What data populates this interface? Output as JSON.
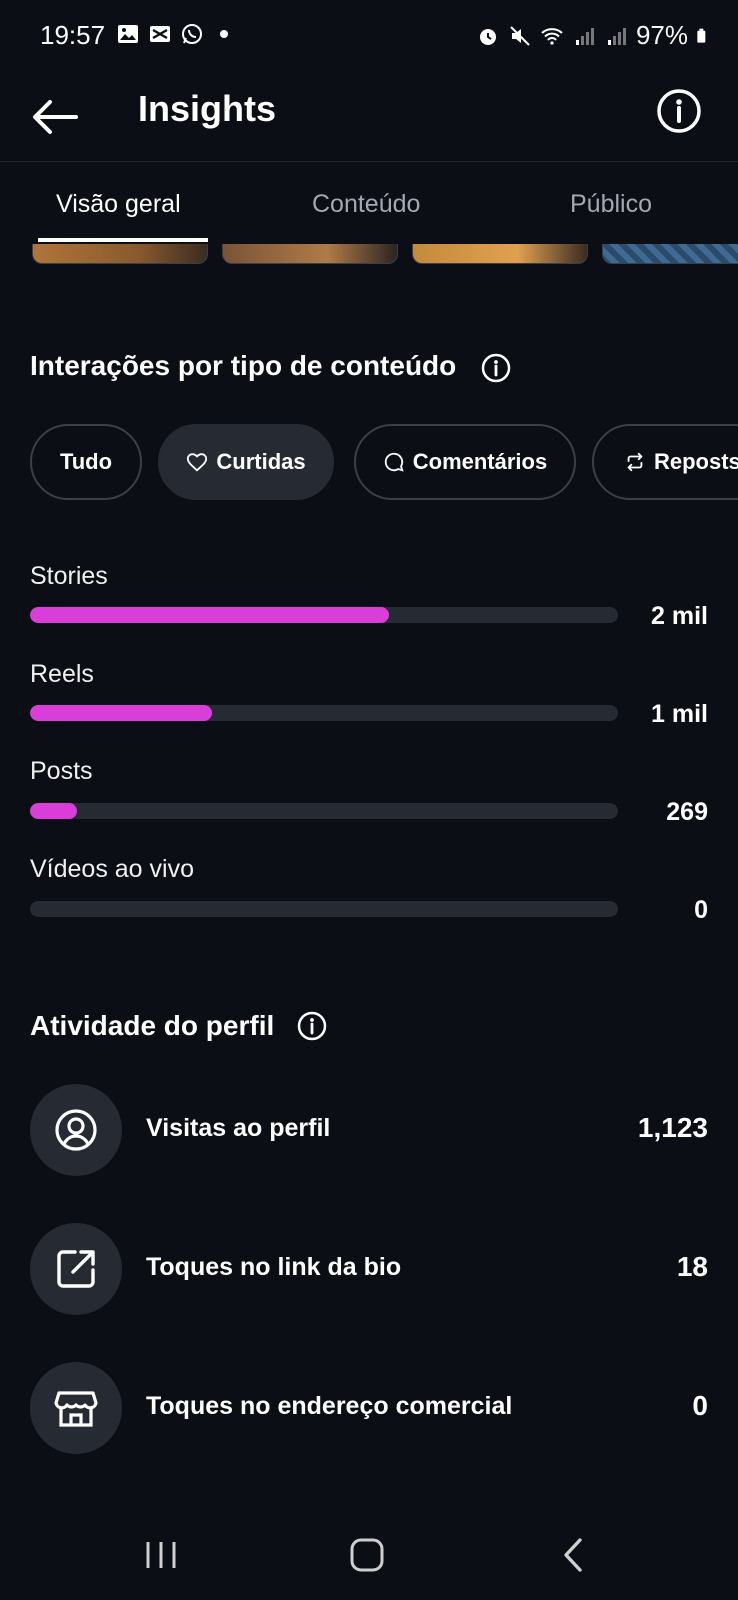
{
  "status": {
    "time": "19:57",
    "battery": "97%"
  },
  "header": {
    "title": "Insights"
  },
  "tabs": [
    {
      "label": "Visão geral"
    },
    {
      "label": "Conteúdo"
    },
    {
      "label": "Público"
    }
  ],
  "interactions": {
    "title": "Interações por tipo de conteúdo",
    "filters": [
      {
        "label": "Tudo",
        "icon": "none"
      },
      {
        "label": "Curtidas",
        "icon": "heart-icon"
      },
      {
        "label": "Comentários",
        "icon": "comment-icon"
      },
      {
        "label": "Reposts",
        "icon": "repost-icon"
      }
    ],
    "selected_filter": "Curtidas",
    "bars": [
      {
        "label": "Stories",
        "value": "2 mil",
        "fraction": 0.61
      },
      {
        "label": "Reels",
        "value": "1 mil",
        "fraction": 0.31
      },
      {
        "label": "Posts",
        "value": "269",
        "fraction": 0.08
      },
      {
        "label": "Vídeos ao vivo",
        "value": "0",
        "fraction": 0
      }
    ],
    "accent_color": "#d93fd8"
  },
  "activity": {
    "title": "Atividade do perfil",
    "items": [
      {
        "label": "Visitas ao perfil",
        "value": "1,123",
        "icon": "profile-icon"
      },
      {
        "label": "Toques no link da bio",
        "value": "18",
        "icon": "external-link-icon"
      },
      {
        "label": "Toques no endereço comercial",
        "value": "0",
        "icon": "store-icon"
      }
    ]
  }
}
